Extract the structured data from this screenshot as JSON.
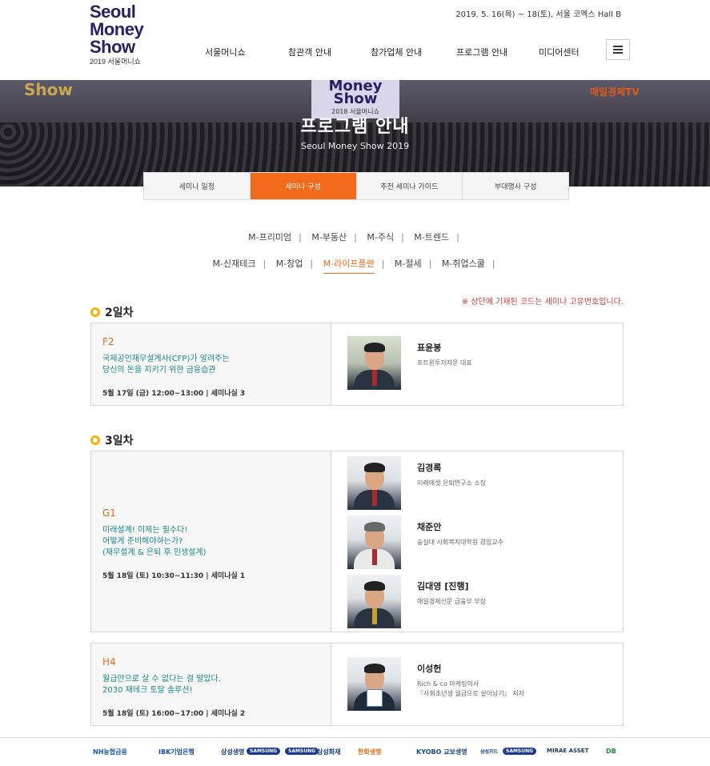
{
  "header": {
    "logo": {
      "line1": "Seoul",
      "line2": "Money",
      "line3": "Show",
      "sub": "2019 서울머니쇼"
    },
    "event_date": "2019. 5. 16(목) ~ 18(토), 서울 코엑스 Hall B",
    "nav": [
      "서울머니쇼",
      "참관객 안내",
      "참가업체 안내",
      "프로그램 안내",
      "미디어센터"
    ],
    "menu_icon": "hamburger-menu-icon"
  },
  "hero": {
    "title": "프로그램 안내",
    "subtitle": "Seoul Money Show 2019",
    "screen_line1": "Money",
    "screen_line2": "Show",
    "screen_sub": "2018 서울머니쇼",
    "left_sign": "Show",
    "right_sign": "매일경제TV"
  },
  "tabs": [
    {
      "label": "세미나 일정",
      "active": false
    },
    {
      "label": "세미나 구성",
      "active": true
    },
    {
      "label": "추천 세미나 가이드",
      "active": false
    },
    {
      "label": "부대행사 구성",
      "active": false
    }
  ],
  "categories": {
    "row1": [
      "M-프리미엄",
      "M-부동산",
      "M-주식",
      "M-트렌드"
    ],
    "row2": [
      "M-신재테크",
      "M-창업",
      "M-라이프플랜",
      "M-절세",
      "M-취업스쿨"
    ],
    "active": "M-라이프플랜"
  },
  "notice": "※ 상단에 기재된 코드는 세미나 고유번호입니다.",
  "days": [
    {
      "label": "2일차",
      "sessions": [
        {
          "code": "F2",
          "title": "국제공인재무설계사(CFP)가 알려주는\n당신의 돈을 지키기 위한 금융습관",
          "when": "5월 17일 (금) 12:00~13:00 | 세미나실 3",
          "speakers": [
            {
              "name": "표윤봉",
              "role": "프트윈투자자문 대표"
            }
          ]
        }
      ]
    },
    {
      "label": "3일차",
      "sessions": [
        {
          "code": "G1",
          "title": "미래설계! 이제는 필수다!\n어떻게 준비해야하는가?\n(재무설계 & 은퇴 후 인생설계)",
          "when": "5월 18일 (토) 10:30~11:30 | 세미나실 1",
          "speakers": [
            {
              "name": "김경록",
              "role": "미래에셋 은퇴연구소 소장"
            },
            {
              "name": "채준안",
              "role": "숭실대 사회복지대학원 겸임교수"
            },
            {
              "name": "김대영 [진행]",
              "role": "매일경제신문 금융부 부장"
            }
          ]
        },
        {
          "code": "H4",
          "title": "월급만으로 살 수 없다는 걸 알았다.\n2030 재테크 토탈 솔루션!",
          "when": "5월 18일 (토) 16:00~17:00 | 세미나실 2",
          "speakers": [
            {
              "name": "이성헌",
              "role": "Rich & co 마케팅이사\n『사회초년생 월급으로 살아남기』 저자"
            }
          ]
        }
      ]
    }
  ],
  "sponsors": [
    "NH농협금융",
    "IBK기업은행",
    "삼성생명",
    "SAMSUNG",
    "SAMSUNG",
    "삼성화재",
    "한화생명",
    "KYOBO 교보생명",
    "삼성카드",
    "SAMSUNG",
    "MIRAE ASSET",
    "DB"
  ],
  "colors": {
    "accent": "#f26b1d",
    "brand": "#2a1f63",
    "teal": "#1a8a8a",
    "notice": "#d23a3a",
    "bullet": "#f5b400"
  }
}
